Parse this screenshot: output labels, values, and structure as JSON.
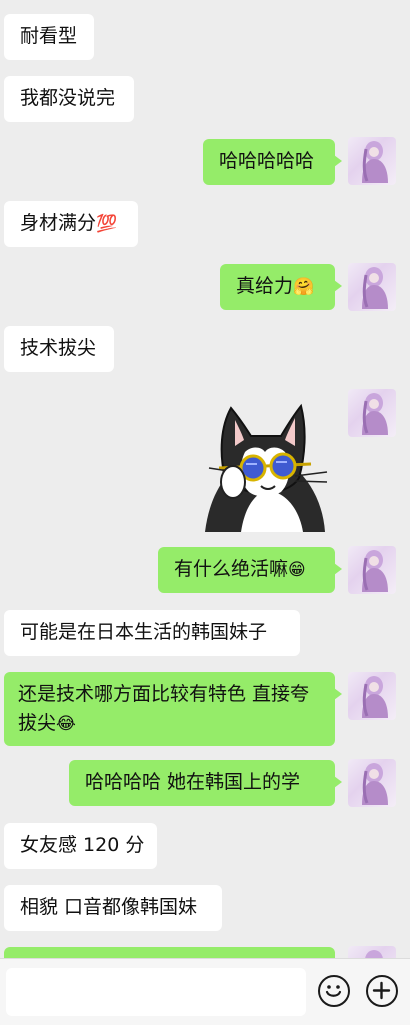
{
  "messages": [
    {
      "side": "in",
      "text": "耐看型"
    },
    {
      "side": "in",
      "text": "我都没说完"
    },
    {
      "side": "out",
      "text": "哈哈哈哈哈"
    },
    {
      "side": "in",
      "text": "身材满分",
      "emoji": "💯"
    },
    {
      "side": "out",
      "text": "真给力",
      "emoji": "🤗"
    },
    {
      "side": "in",
      "text": "技术拔尖"
    },
    {
      "side": "out",
      "sticker": "cat-with-sunglasses-sticker"
    },
    {
      "side": "out",
      "text": "有什么绝活嘛",
      "emoji": "😁"
    },
    {
      "side": "in",
      "text": "可能是在日本生活的韩国妹子"
    },
    {
      "side": "out",
      "text": "还是技术哪方面比较有特色 直接夸拔尖",
      "emoji": "😂"
    },
    {
      "side": "out",
      "text": "哈哈哈哈 她在韩国上的学"
    },
    {
      "side": "in",
      "text": "女友感 120 分"
    },
    {
      "side": "in",
      "text": "相貌 口音都像韩国妹"
    }
  ],
  "composer": {
    "emoji_button_icon": "smiley-face-icon",
    "add_button_icon": "plus-circle-icon"
  }
}
